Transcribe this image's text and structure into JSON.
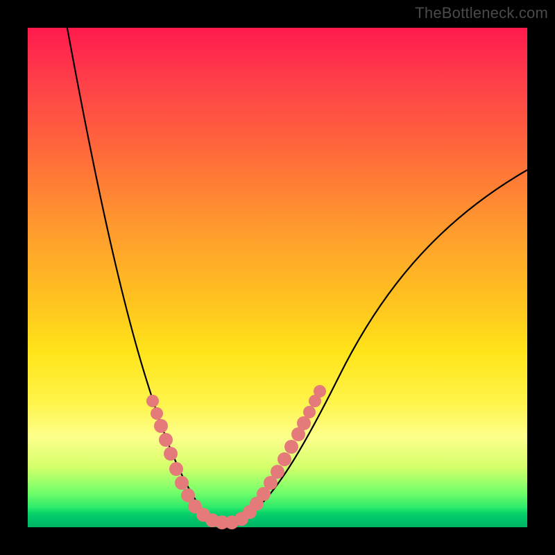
{
  "watermark": "TheBottleneck.com",
  "colors": {
    "gradient_top": "#ff1a4d",
    "gradient_bottom": "#00c46a",
    "curve": "#000000",
    "highlight_dot": "#e47a7a",
    "frame": "#000000"
  },
  "chart_data": {
    "type": "line",
    "title": "",
    "xlabel": "",
    "ylabel": "",
    "xlim": [
      0,
      100
    ],
    "ylim": [
      0,
      100
    ],
    "grid": false,
    "legend": false,
    "background_gradient": {
      "orientation": "vertical",
      "stops": [
        {
          "pos": 0.0,
          "color": "#ff1a4d"
        },
        {
          "pos": 0.25,
          "color": "#ff6a3a"
        },
        {
          "pos": 0.55,
          "color": "#ffc41f"
        },
        {
          "pos": 0.75,
          "color": "#fff44a"
        },
        {
          "pos": 0.93,
          "color": "#73ff6a"
        },
        {
          "pos": 1.0,
          "color": "#00c46a"
        }
      ]
    },
    "series": [
      {
        "name": "bottleneck_curve",
        "style": "line",
        "color": "#000000",
        "x": [
          8,
          12,
          18,
          24,
          28,
          32,
          35,
          38,
          41,
          44,
          50,
          56,
          62,
          70,
          82,
          100
        ],
        "y": [
          100,
          78,
          55,
          38,
          28,
          18,
          10,
          4,
          1,
          0,
          3,
          12,
          25,
          40,
          56,
          72
        ]
      },
      {
        "name": "highlighted_points",
        "style": "scatter",
        "color": "#e47a7a",
        "x": [
          25,
          26,
          27,
          28,
          29,
          30,
          31,
          32,
          34,
          35,
          37,
          39,
          41,
          43,
          44,
          46,
          48,
          50,
          51,
          53,
          54,
          56,
          57,
          58,
          59
        ],
        "y": [
          25,
          23,
          20,
          18,
          15,
          12,
          9,
          6,
          3,
          2,
          1,
          1,
          1,
          3,
          5,
          8,
          11,
          14,
          17,
          20,
          22,
          24,
          26,
          27,
          28
        ]
      }
    ],
    "annotations": []
  }
}
